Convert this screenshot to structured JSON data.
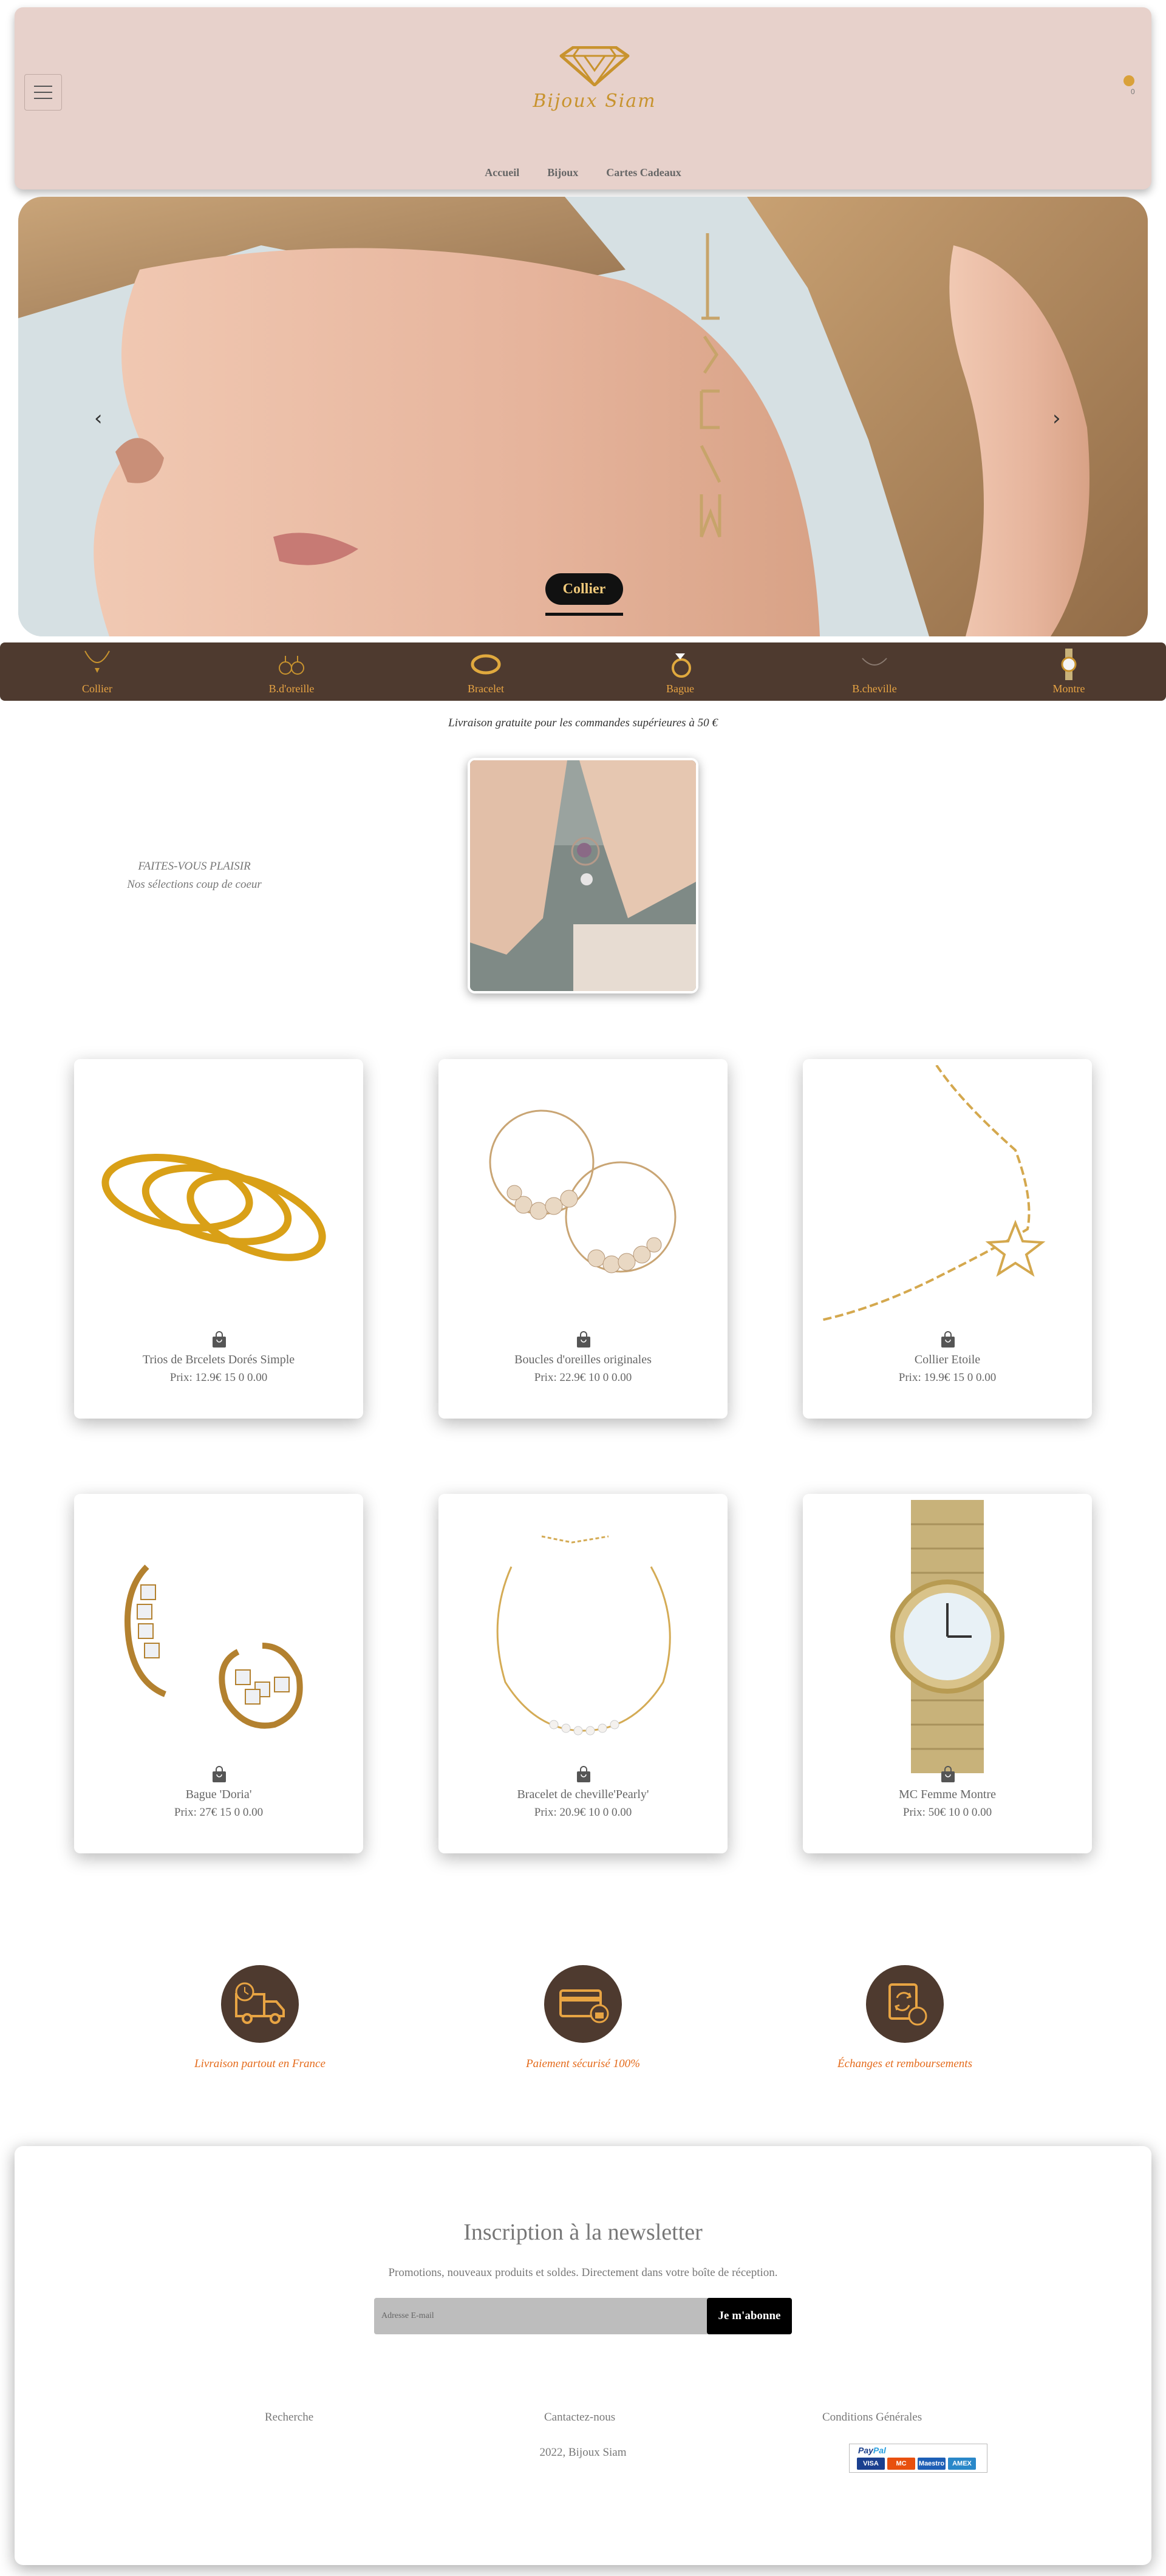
{
  "header": {
    "logo_text": "Bijoux Siam",
    "cart_count": "0",
    "nav": [
      "Accueil",
      "Bijoux",
      "Cartes Cadeaux"
    ]
  },
  "hero": {
    "caption": "Collier"
  },
  "categories": [
    "Collier",
    "B.d'oreille",
    "Bracelet",
    "Bague",
    "B.cheville",
    "Montre"
  ],
  "shipping_note": "Livraison gratuite pour les commandes supérieures à 50 €",
  "feature": {
    "title": "FAITES-VOUS PLAISIR",
    "subtitle": "Nos sélections coup de coeur"
  },
  "products": [
    {
      "name": "Trios de Brcelets Dorés Simple",
      "price": "Prix: 12.9€ 15 0 0.00"
    },
    {
      "name": "Boucles d'oreilles originales",
      "price": "Prix: 22.9€ 10 0 0.00"
    },
    {
      "name": "Collier Etoile",
      "price": "Prix: 19.9€ 15 0 0.00"
    },
    {
      "name": "Bague 'Doria'",
      "price": "Prix: 27€ 15 0 0.00"
    },
    {
      "name": "Bracelet de cheville'Pearly'",
      "price": "Prix: 20.9€ 10 0 0.00"
    },
    {
      "name": "MC Femme Montre",
      "price": "Prix: 50€ 10 0 0.00"
    }
  ],
  "services": [
    {
      "label": "Livraison partout en France",
      "icon": "truck-icon"
    },
    {
      "label": "Paiement sécurisé 100%",
      "icon": "secure-card-icon"
    },
    {
      "label": "Échanges et remboursements",
      "icon": "exchange-icon"
    }
  ],
  "newsletter": {
    "title": "Inscription à la newsletter",
    "subtitle": "Promotions, nouveaux produits et soldes. Directement dans votre boîte de réception.",
    "placeholder": "Adresse E-mail",
    "button": "Je m'abonne"
  },
  "footer": {
    "links": [
      "Recherche",
      "Cantactez-nous",
      "Conditions Générales"
    ],
    "copyright": "2022, Bijoux Siam",
    "payment": {
      "brand_a": "Pay",
      "brand_b": "Pal",
      "cards": [
        "VISA",
        "MC",
        "Maestro",
        "AMEX"
      ]
    }
  },
  "colors": {
    "header_bg": "#e7d1cb",
    "brand_gold": "#c8932e",
    "category_bar": "#4e3a2f",
    "accent_orange": "#e46a1a"
  }
}
